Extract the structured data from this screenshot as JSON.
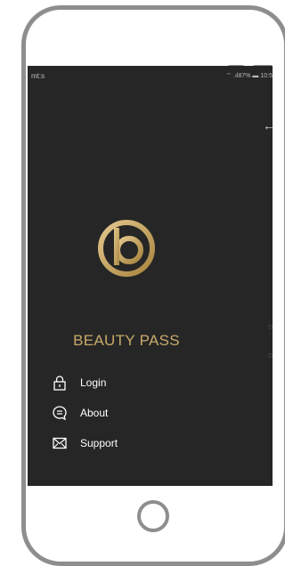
{
  "status": {
    "carrier": "mt:s",
    "right": "⁠⌔ .ıl87% ▬ 10:5"
  },
  "brand": {
    "name": "BEAUTY PASS"
  },
  "menu": [
    {
      "label": "Login",
      "icon": "lock-icon"
    },
    {
      "label": "About",
      "icon": "chat-bubble-icon"
    },
    {
      "label": "Support",
      "icon": "envelope-icon"
    }
  ],
  "content": {
    "back_icon": "arrow-left-icon"
  },
  "colors": {
    "background": "#262626",
    "gold": "#c9a96b",
    "button_light": "#e8dcc6",
    "button_gold": "#caa866",
    "frame": "#8e8e8e"
  }
}
